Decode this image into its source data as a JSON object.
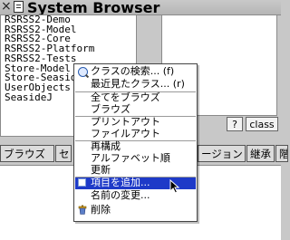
{
  "window": {
    "close_glyph": "×",
    "title": "System Browser"
  },
  "packages": [
    "RSRSS2-Demo",
    "RSRSS2-Model",
    "RSRSS2-Core",
    "RSRSS2-Platform",
    "RSRSS2-Tests",
    "Store-Model",
    "Store-Seaside",
    "UserObjects",
    "SeasideJ"
  ],
  "buttons": {
    "query": "?",
    "class": "class"
  },
  "tabs": [
    {
      "label": "ブラウズ"
    },
    {
      "label": "セ"
    },
    {
      "label": "ージョン"
    },
    {
      "label": "継承"
    },
    {
      "label": "階"
    }
  ],
  "context_menu": {
    "items": [
      {
        "label": "クラスの検索... (f)",
        "icon": "search-icon"
      },
      {
        "label": "最近見たクラス... (r)"
      },
      {
        "label": "全てをブラウズ"
      },
      {
        "label": "ブラウズ"
      },
      {
        "label": "プリントアウト"
      },
      {
        "label": "ファイルアウト"
      },
      {
        "label": "再構成"
      },
      {
        "label": "アルファベット順"
      },
      {
        "label": "更新"
      },
      {
        "label": "項目を追加...",
        "icon": "add-item-icon",
        "selected": true
      },
      {
        "label": "名前の変更..."
      },
      {
        "label": "削除",
        "icon": "trash-icon"
      }
    ]
  },
  "colors": {
    "selection": "#1e3ac8",
    "window_bg": "#c8c8c8"
  }
}
